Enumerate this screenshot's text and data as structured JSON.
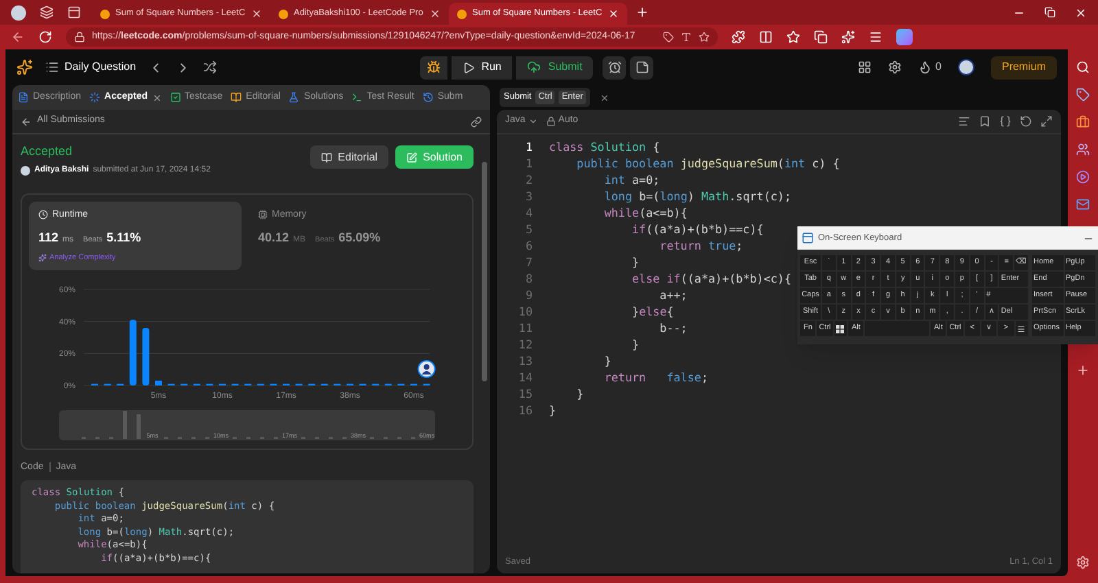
{
  "browser": {
    "tabs": [
      {
        "title": "Sum of Square Numbers - LeetC",
        "selected": false
      },
      {
        "title": "AdityaBakshi100 - LeetCode Pro",
        "selected": false
      },
      {
        "title": "Sum of Square Numbers - LeetC",
        "selected": true
      }
    ],
    "address": "https://**leetcode.com**/problems/sum-of-square-numbers/submissions/1291046247/?envType=daily-question&envId=2024-06-17"
  },
  "header": {
    "title": "Daily Question",
    "run": "Run",
    "submit": "Submit",
    "streak": "0",
    "premium": "Premium"
  },
  "left_panel": {
    "tabs": [
      {
        "label": "Description",
        "selected": false,
        "closable": false
      },
      {
        "label": "Accepted",
        "selected": true,
        "closable": true
      },
      {
        "label": "Testcase",
        "selected": false,
        "closable": false
      },
      {
        "label": "Editorial",
        "selected": false,
        "closable": false
      },
      {
        "label": "Solutions",
        "selected": false,
        "closable": false
      },
      {
        "label": "Test Result",
        "selected": false,
        "closable": false
      },
      {
        "label": "Subm",
        "selected": false,
        "closable": false
      }
    ],
    "back": "All Submissions",
    "status": "Accepted",
    "author": "Aditya Bakshi",
    "submitted": "submitted at Jun 17, 2024 14:52",
    "editorial_button": "Editorial",
    "solution_button": "Solution",
    "stats": [
      {
        "label": "Runtime",
        "value": "112",
        "unit": "ms",
        "beats_label": "Beats",
        "beats": "5.11%",
        "link": "Analyze Complexity",
        "selected": true
      },
      {
        "label": "Memory",
        "value": "40.12",
        "unit": "MB",
        "beats_label": "Beats",
        "beats": "65.09%",
        "selected": false
      }
    ],
    "chart_data": {
      "type": "bar",
      "categories": [
        null,
        null,
        null,
        null,
        null,
        "5ms",
        null,
        null,
        null,
        null,
        "10ms",
        null,
        null,
        null,
        null,
        "17ms",
        null,
        null,
        null,
        null,
        "38ms",
        null,
        null,
        null,
        null,
        "60ms",
        null
      ],
      "values": [
        1,
        1,
        1,
        41,
        36,
        3,
        1,
        1,
        1,
        1,
        1,
        1,
        1,
        1,
        1,
        1,
        1,
        1,
        1,
        1,
        1,
        1,
        1,
        1,
        1,
        1,
        1
      ],
      "yticks": [
        {
          "value": 0,
          "label": "0%"
        },
        {
          "value": 20,
          "label": "20%"
        },
        {
          "value": 40,
          "label": "40%"
        },
        {
          "value": 60,
          "label": "60%"
        }
      ],
      "ylim": [
        0,
        60
      ]
    },
    "range_labels": [
      "5ms",
      "10ms",
      "17ms",
      "38ms",
      "60ms"
    ],
    "code_label": "Code",
    "language": "Java",
    "code": [
      [
        {
          "kind": "keyword",
          "text": "class "
        },
        {
          "kind": "class",
          "text": "Solution "
        },
        {
          "kind": "plain",
          "text": "{"
        }
      ],
      [
        {
          "kind": "type",
          "text": "    public boolean "
        },
        {
          "kind": "function",
          "text": "judgeSquareSum"
        },
        {
          "kind": "plain",
          "text": "("
        },
        {
          "kind": "type",
          "text": "int "
        },
        {
          "kind": "plain",
          "text": "c) {"
        }
      ],
      [
        {
          "kind": "type",
          "text": "        int "
        },
        {
          "kind": "plain",
          "text": "a=0;"
        }
      ],
      [
        {
          "kind": "type",
          "text": "        long "
        },
        {
          "kind": "plain",
          "text": "b=("
        },
        {
          "kind": "type",
          "text": "long"
        },
        {
          "kind": "plain",
          "text": ") "
        },
        {
          "kind": "class",
          "text": "Math"
        },
        {
          "kind": "plain",
          "text": ".sqrt(c);"
        }
      ],
      [
        {
          "kind": "keyword",
          "text": "        while"
        },
        {
          "kind": "plain",
          "text": "(a<=b){"
        }
      ],
      [
        {
          "kind": "keyword",
          "text": "            if"
        },
        {
          "kind": "plain",
          "text": "((a*a)+(b*b)==c){"
        }
      ]
    ]
  },
  "editor": {
    "submit_hint": "Submit",
    "keys": [
      "Ctrl",
      "Enter"
    ],
    "language": "Java",
    "mode": "Auto",
    "lines": [
      {
        "number": "1",
        "current": true,
        "tokens": [
          {
            "kind": "keyword",
            "text": "class "
          },
          {
            "kind": "class",
            "text": "Solution "
          },
          {
            "kind": "plain",
            "text": "{"
          }
        ]
      },
      {
        "number": "1",
        "current": false,
        "tokens": [
          {
            "kind": "type",
            "text": "    public boolean "
          },
          {
            "kind": "function",
            "text": "judgeSquareSum"
          },
          {
            "kind": "plain",
            "text": "("
          },
          {
            "kind": "type",
            "text": "int "
          },
          {
            "kind": "plain",
            "text": "c) {"
          }
        ]
      },
      {
        "number": "2",
        "current": false,
        "tokens": [
          {
            "kind": "type",
            "text": "        int "
          },
          {
            "kind": "plain",
            "text": "a=0;"
          }
        ]
      },
      {
        "number": "3",
        "current": false,
        "tokens": [
          {
            "kind": "type",
            "text": "        long "
          },
          {
            "kind": "plain",
            "text": "b=("
          },
          {
            "kind": "type",
            "text": "long"
          },
          {
            "kind": "plain",
            "text": ") "
          },
          {
            "kind": "class",
            "text": "Math"
          },
          {
            "kind": "plain",
            "text": ".sqrt(c);"
          }
        ]
      },
      {
        "number": "4",
        "current": false,
        "tokens": [
          {
            "kind": "keyword",
            "text": "        while"
          },
          {
            "kind": "plain",
            "text": "(a<=b){"
          }
        ]
      },
      {
        "number": "5",
        "current": false,
        "tokens": [
          {
            "kind": "keyword",
            "text": "            if"
          },
          {
            "kind": "plain",
            "text": "((a*a)+(b*b)==c){"
          }
        ]
      },
      {
        "number": "6",
        "current": false,
        "tokens": [
          {
            "kind": "keyword",
            "text": "                return "
          },
          {
            "kind": "type",
            "text": "true"
          },
          {
            "kind": "plain",
            "text": ";"
          }
        ]
      },
      {
        "number": "7",
        "current": false,
        "tokens": [
          {
            "kind": "plain",
            "text": "            }"
          }
        ]
      },
      {
        "number": "8",
        "current": false,
        "tokens": [
          {
            "kind": "keyword",
            "text": "            else if"
          },
          {
            "kind": "plain",
            "text": "((a*a)+(b*b)<c){"
          }
        ]
      },
      {
        "number": "9",
        "current": false,
        "tokens": [
          {
            "kind": "plain",
            "text": "                a++;"
          }
        ]
      },
      {
        "number": "10",
        "current": false,
        "tokens": [
          {
            "kind": "plain",
            "text": "            }"
          },
          {
            "kind": "keyword",
            "text": "else"
          },
          {
            "kind": "plain",
            "text": "{"
          }
        ]
      },
      {
        "number": "11",
        "current": false,
        "tokens": [
          {
            "kind": "plain",
            "text": "                b--;"
          }
        ]
      },
      {
        "number": "12",
        "current": false,
        "tokens": [
          {
            "kind": "plain",
            "text": "            }"
          }
        ]
      },
      {
        "number": "13",
        "current": false,
        "tokens": [
          {
            "kind": "plain",
            "text": "        }"
          }
        ]
      },
      {
        "number": "14",
        "current": false,
        "tokens": [
          {
            "kind": "keyword",
            "text": "        return"
          },
          {
            "kind": "type",
            "text": "   false"
          },
          {
            "kind": "plain",
            "text": ";"
          }
        ]
      },
      {
        "number": "15",
        "current": false,
        "tokens": [
          {
            "kind": "plain",
            "text": "    }"
          }
        ]
      },
      {
        "number": "16",
        "current": false,
        "tokens": [
          {
            "kind": "plain",
            "text": "}"
          }
        ]
      }
    ],
    "status": "Saved",
    "position": "Ln 1, Col 1"
  },
  "keyboard": {
    "title": "On-Screen Keyboard",
    "rows": [
      [
        "Esc",
        "`",
        "1",
        "2",
        "3",
        "4",
        "5",
        "6",
        "7",
        "8",
        "9",
        "0",
        "-",
        "=",
        "⌫"
      ],
      [
        "Tab",
        "q",
        "w",
        "e",
        "r",
        "t",
        "y",
        "u",
        "i",
        "o",
        "p",
        "[",
        "]",
        "Enter"
      ],
      [
        "Caps",
        "a",
        "s",
        "d",
        "f",
        "g",
        "h",
        "j",
        "k",
        "l",
        ";",
        "'",
        "#"
      ],
      [
        "Shift",
        "\\",
        "z",
        "x",
        "c",
        "v",
        "b",
        "n",
        "m",
        ",",
        ".",
        "/",
        "∧",
        "Del"
      ]
    ],
    "bottom_row": [
      {
        "kind": "key",
        "label": "Fn"
      },
      {
        "kind": "key",
        "label": "Ctrl"
      },
      {
        "kind": "windows"
      },
      {
        "kind": "key",
        "label": "Alt"
      },
      {
        "kind": "space"
      },
      {
        "kind": "key",
        "label": "Alt"
      },
      {
        "kind": "key",
        "label": "Ctrl"
      },
      {
        "kind": "key",
        "label": "<"
      },
      {
        "kind": "key",
        "label": "∨"
      },
      {
        "kind": "key",
        "label": ">"
      },
      {
        "kind": "menu"
      }
    ],
    "nav": [
      [
        "Home",
        "PgUp"
      ],
      [
        "End",
        "PgDn"
      ],
      [
        "Insert",
        "Pause"
      ],
      [
        "PrtScn",
        "ScrLk"
      ],
      [
        "Options",
        "Help"
      ]
    ]
  }
}
